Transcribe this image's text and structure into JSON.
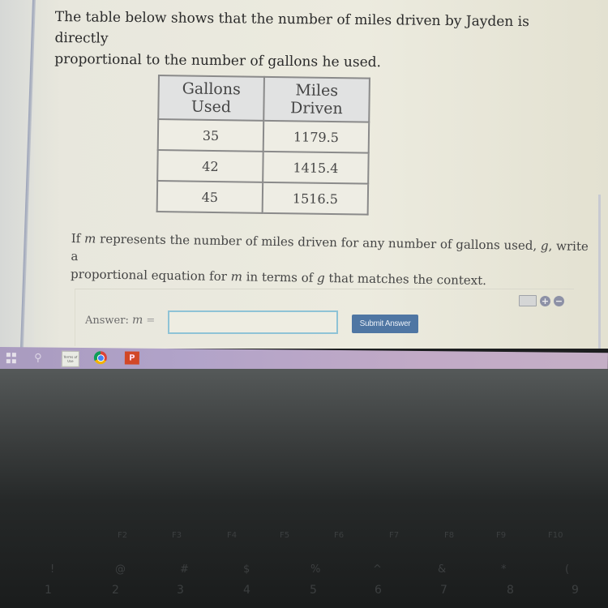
{
  "problem": {
    "intro_lines": [
      "The table below shows that the number of miles driven by Jayden is directly",
      "proportional to the number of gallons he used."
    ],
    "table": {
      "headers": [
        "Gallons Used",
        "Miles Driven"
      ],
      "rows": [
        {
          "gallons": "35",
          "miles": "1179.5"
        },
        {
          "gallons": "42",
          "miles": "1415.4"
        },
        {
          "gallons": "45",
          "miles": "1516.5"
        }
      ]
    },
    "question_line1_prefix": "If",
    "question_var_m": "m",
    "question_line1_mid": "represents the number of miles driven for any number of gallons used,",
    "question_var_g": "g",
    "question_line1_suffix": ", write a",
    "question_line2_prefix": "proportional equation for",
    "question_line2_m": "m",
    "question_line2_mid": "in terms of",
    "question_line2_g": "g",
    "question_line2_suffix": "that matches the context."
  },
  "answer": {
    "label": "Answer:",
    "variable": "m",
    "equals": "=",
    "input_value": "",
    "submit_label": "Submit Answer",
    "tools": {
      "keyboard_icon": "keyboard-icon",
      "plus_icon": "+",
      "minus_icon": "−"
    }
  },
  "taskbar": {
    "items": [
      {
        "name": "windows-start",
        "icon": "windows-icon"
      },
      {
        "name": "search",
        "icon": "search-icon",
        "glyph": "⚲"
      },
      {
        "name": "sticky-notes",
        "icon": "notes-icon",
        "text": "Terms of Use"
      },
      {
        "name": "chrome",
        "icon": "chrome-icon"
      },
      {
        "name": "powerpoint",
        "icon": "powerpoint-icon",
        "text": "P"
      }
    ]
  },
  "keyboard": {
    "fn_row": [
      "F2",
      "F3",
      "F4",
      "F5",
      "F6",
      "F7",
      "F8",
      "F9",
      "F10"
    ],
    "symbol_row": [
      "!",
      "@",
      "#",
      "$",
      "%",
      "^",
      "&",
      "*",
      "("
    ],
    "number_row": [
      "1",
      "2",
      "3",
      "4",
      "5",
      "6",
      "7",
      "8",
      "9"
    ]
  },
  "colors": {
    "submit_button": "#4f76a3",
    "input_border": "#8fc3d6",
    "taskbar": "#b1a3c9"
  }
}
